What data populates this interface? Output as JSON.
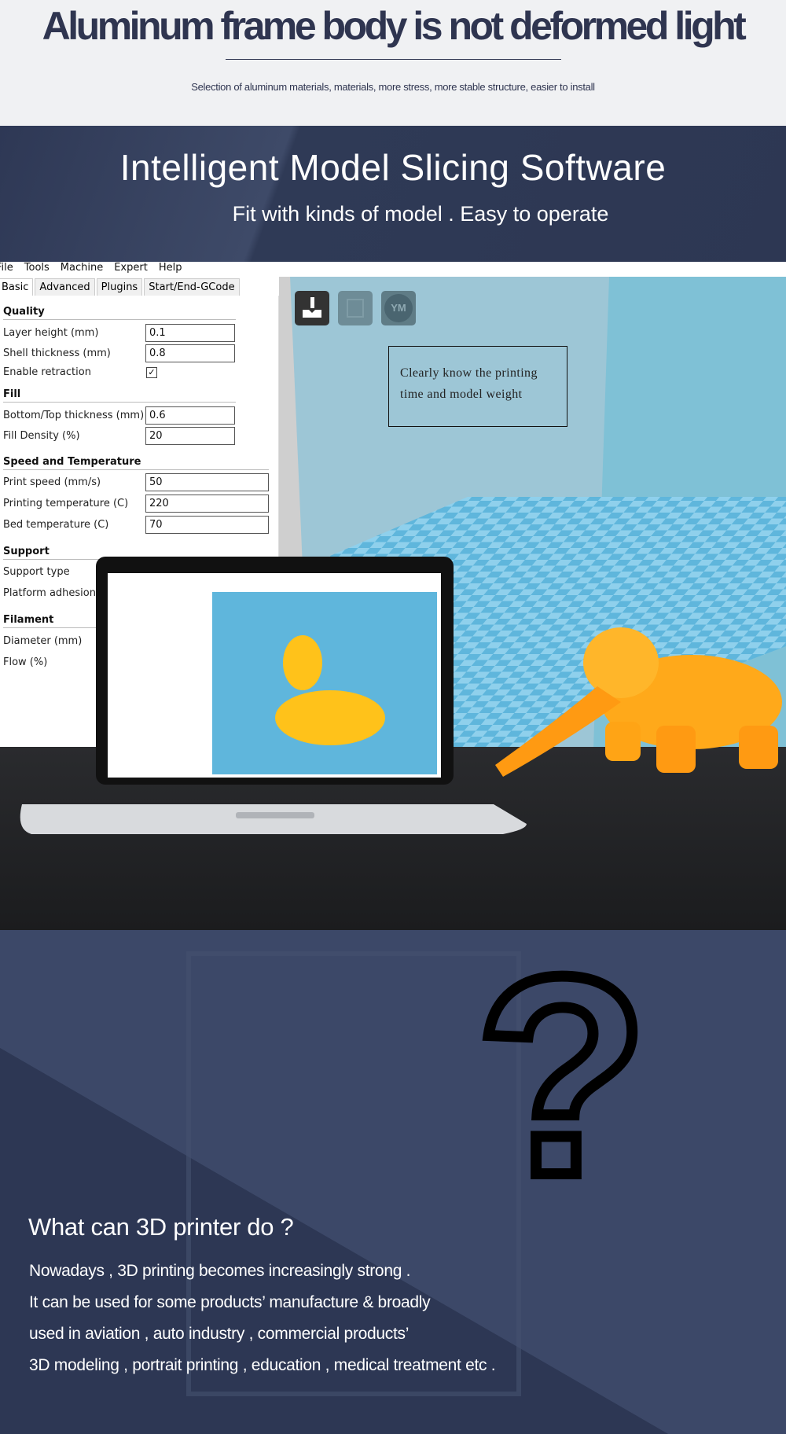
{
  "header": {
    "title": "Aluminum frame body is not deformed light",
    "subtitle": "Selection of aluminum materials, materials, more stress, more stable structure, easier to install"
  },
  "banner": {
    "title": "Intelligent Model Slicing Software",
    "subtitle": "Fit with kinds of model . Easy to operate"
  },
  "software": {
    "menu": [
      "File",
      "Tools",
      "Machine",
      "Expert",
      "Help"
    ],
    "tabs": [
      "Basic",
      "Advanced",
      "Plugins",
      "Start/End-GCode"
    ],
    "sections": {
      "quality": "Quality",
      "fill": "Fill",
      "speed": "Speed and Temperature",
      "support": "Support",
      "filament": "Filament"
    },
    "fields": {
      "layer_height": {
        "label": "Layer height (mm)",
        "value": "0.1"
      },
      "shell_thickness": {
        "label": "Shell thickness (mm)",
        "value": "0.8"
      },
      "enable_retraction": {
        "label": "Enable retraction",
        "checked": true
      },
      "bottom_top": {
        "label": "Bottom/Top thickness (mm)",
        "value": "0.6"
      },
      "fill_density": {
        "label": "Fill Density (%)",
        "value": "20"
      },
      "print_speed": {
        "label": "Print speed (mm/s)",
        "value": "50"
      },
      "print_temp": {
        "label": "Printing temperature (C)",
        "value": "220"
      },
      "bed_temp": {
        "label": "Bed temperature (C)",
        "value": "70"
      },
      "support_type": {
        "label": "Support type"
      },
      "platform_adhesion": {
        "label": "Platform adhesion"
      },
      "diameter": {
        "label": "Diameter (mm)"
      },
      "flow": {
        "label": "Flow (%)"
      }
    },
    "toolbar": {
      "load_icon": "load-model-icon",
      "save_icon": "save-icon",
      "ym_label": "YM"
    },
    "callout": {
      "line1": "Clearly know the printing",
      "line2": "time and model weight"
    }
  },
  "bottom": {
    "title": "What can 3D printer do ?",
    "lines": [
      "Nowadays , 3D printing becomes increasingly strong .",
      "It can be used for some products’ manufacture & broadly",
      "used in aviation , auto industry , commercial products’",
      "3D modeling ,  portrait printing , education , medical treatment etc ."
    ],
    "symbol": "?"
  },
  "colors": {
    "navy": "#2f3a56",
    "viewport": "#9dc6d6",
    "grid": "#5fb6dc",
    "elephant": "#ffb21c"
  }
}
